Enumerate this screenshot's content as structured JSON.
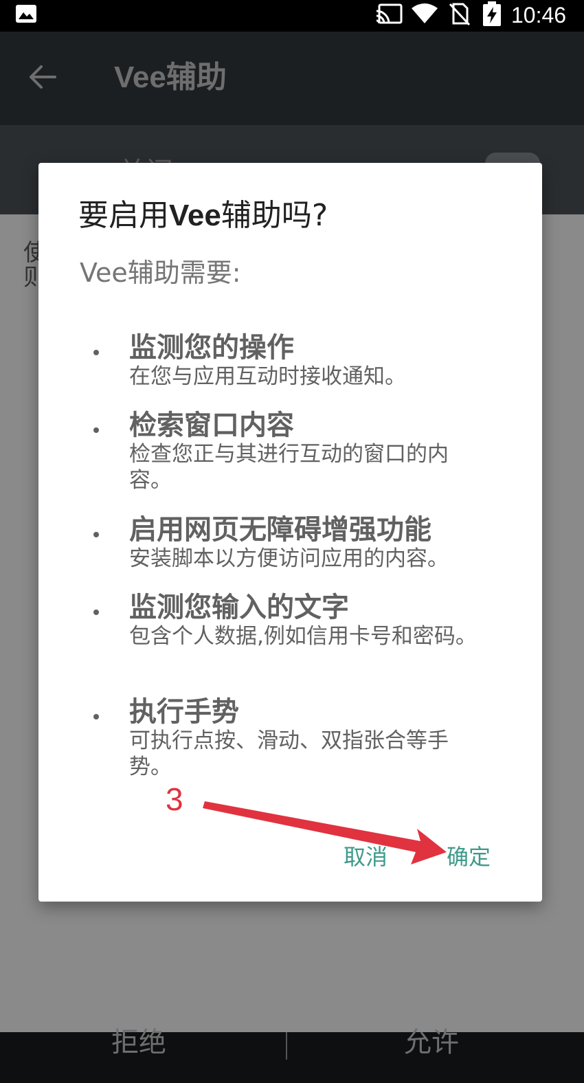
{
  "status_bar": {
    "time": "10:46",
    "icons": [
      "gallery-icon",
      "cast-icon",
      "wifi-icon",
      "no-sim-icon",
      "battery-charging-icon"
    ]
  },
  "app": {
    "title": "Vee辅助",
    "toggle_label": "关闭",
    "description_fragment": "使则",
    "bottom_buttons": {
      "deny": "拒绝",
      "allow": "允许"
    }
  },
  "dialog": {
    "title_prefix": "要启用",
    "title_app": "Vee",
    "title_suffix": "辅助吗?",
    "subtitle": "Vee辅助需要:",
    "permissions": [
      {
        "title": "监测您的操作",
        "description": "在您与应用互动时接收通知。"
      },
      {
        "title": "检索窗口内容",
        "description": "检查您正与其进行互动的窗口的内容。"
      },
      {
        "title": "启用网页无障碍增强功能",
        "description": "安装脚本以方便访问应用的内容。"
      },
      {
        "title": "监测您输入的文字",
        "description": "包含个人数据,例如信用卡号和密码。"
      },
      {
        "title": "执行手势",
        "description": "可执行点按、滑动、双指张合等手势。"
      }
    ],
    "cancel_label": "取消",
    "ok_label": "确定"
  },
  "annotation": {
    "step_number": "3",
    "color": "#e0333f"
  },
  "colors": {
    "accent": "#3e9a8a",
    "scrim": "#8a8a8a"
  }
}
